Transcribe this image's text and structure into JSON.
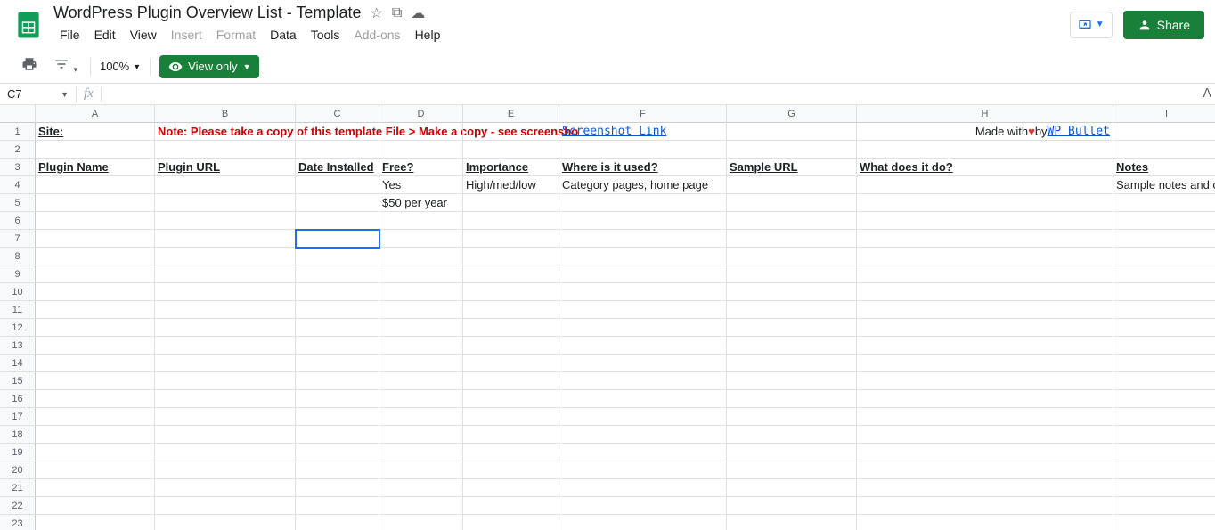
{
  "doc": {
    "title": "WordPress Plugin Overview List - Template"
  },
  "menu": {
    "file": "File",
    "edit": "Edit",
    "view": "View",
    "insert": "Insert",
    "format": "Format",
    "data": "Data",
    "tools": "Tools",
    "addons": "Add-ons",
    "help": "Help"
  },
  "header": {
    "share": "Share"
  },
  "toolbar": {
    "zoom": "100%",
    "view_only": "View only"
  },
  "formula_bar": {
    "name_box": "C7",
    "fx": "fx"
  },
  "columns": [
    "A",
    "B",
    "C",
    "D",
    "E",
    "F",
    "G",
    "H",
    "I"
  ],
  "rows": [
    "1",
    "2",
    "3",
    "4",
    "5",
    "6",
    "7",
    "8",
    "9",
    "10",
    "11",
    "12",
    "13",
    "14",
    "15",
    "16",
    "17",
    "18",
    "19",
    "20",
    "21",
    "22",
    "23"
  ],
  "cells": {
    "r1": {
      "A": "Site:",
      "B": "Note: Please take a copy of this template File > Make a copy - see screensho",
      "F": "Screenshot Link",
      "H_pre": "Made with ",
      "H_post": " by ",
      "H_link": "WP Bullet"
    },
    "r3": {
      "A": "Plugin Name",
      "B": "Plugin URL",
      "C": "Date Installed",
      "D": "Free?",
      "E": "Importance",
      "F": "Where is it used?",
      "G": "Sample URL",
      "H": "What does it do?",
      "I": "Notes"
    },
    "r4": {
      "D": "Yes",
      "E": "High/med/low",
      "F": "Category pages, home page",
      "I": "Sample notes and c"
    },
    "r5": {
      "D": "$50 per year"
    }
  }
}
